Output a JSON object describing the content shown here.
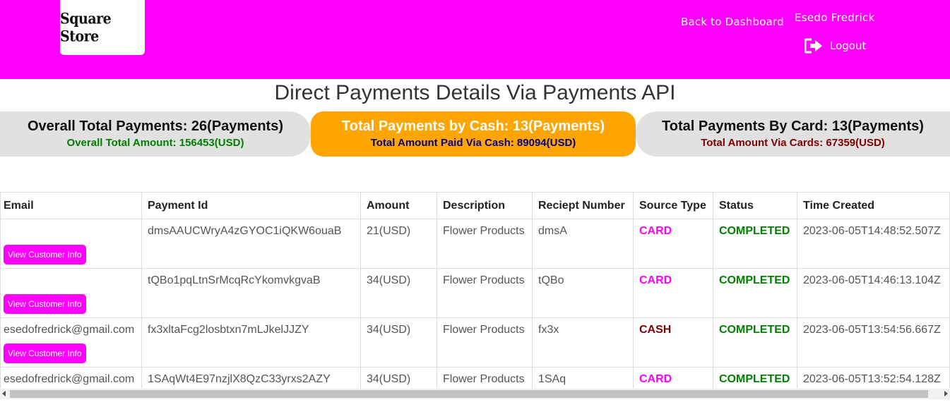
{
  "header": {
    "logo_text": "Square Store",
    "back_link": "Back to Dashboard",
    "user_name": "Esedo Fredrick",
    "logout_label": "Logout",
    "brand_color": "#ff00ff"
  },
  "page": {
    "title": "Direct Payments Details Via Payments API"
  },
  "summary": {
    "overall": {
      "main": "Overall Total Payments: 26(Payments)",
      "sub": "Overall Total Amount: 156453(USD)"
    },
    "cash": {
      "main": "Total Payments by Cash: 13(Payments)",
      "sub": "Total Amount Paid Via Cash: 89094(USD)"
    },
    "card": {
      "main": "Total Payments By Card: 13(Payments)",
      "sub": "Total Amount Via Cards: 67359(USD)"
    }
  },
  "table": {
    "columns": [
      "Email",
      "Payment Id",
      "Amount",
      "Description",
      "Reciept Number",
      "Source Type",
      "Status",
      "Time Created"
    ],
    "view_button_label": "View Customer Info",
    "rows": [
      {
        "email": "",
        "payment_id": "dmsAAUCWryA4zGYOC1iQKW6ouaB",
        "amount": "21(USD)",
        "description": "Flower Products",
        "receipt": "dmsA",
        "source": "CARD",
        "status": "COMPLETED",
        "time": "2023-06-05T14:48:52.507Z"
      },
      {
        "email": "",
        "payment_id": "tQBo1pqLtnSrMcqRcYkomvkgvaB",
        "amount": "34(USD)",
        "description": "Flower Products",
        "receipt": "tQBo",
        "source": "CARD",
        "status": "COMPLETED",
        "time": "2023-06-05T14:46:13.104Z"
      },
      {
        "email": "esedofredrick@gmail.com",
        "payment_id": "fx3xltaFcg2losbtxn7mLJkelJJZY",
        "amount": "34(USD)",
        "description": "Flower Products",
        "receipt": "fx3x",
        "source": "CASH",
        "status": "COMPLETED",
        "time": "2023-06-05T13:54:56.667Z"
      },
      {
        "email": "esedofredrick@gmail.com",
        "payment_id": "1SAqWt4E97nzjlX8QzC33yrxs2AZY",
        "amount": "34(USD)",
        "description": "Flower Products",
        "receipt": "1SAq",
        "source": "CARD",
        "status": "COMPLETED",
        "time": "2023-06-05T13:52:54.128Z"
      }
    ]
  },
  "colors": {
    "card_source": "#ff00ff",
    "cash_source": "#800000",
    "status_completed": "#008000",
    "cash_summary_bg": "#ffa500"
  }
}
